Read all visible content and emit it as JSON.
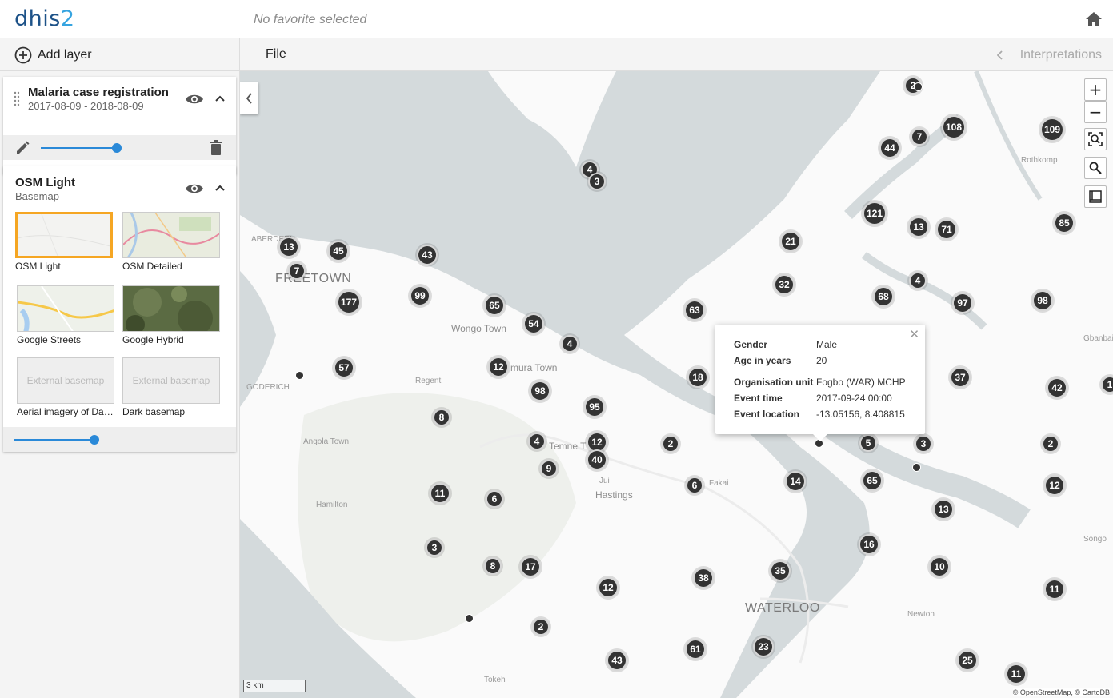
{
  "app": {
    "logo_main": "dhis",
    "logo_num": "2",
    "favorite": "No favorite selected"
  },
  "sidebar": {
    "add_layer_label": "Add layer",
    "layers": [
      {
        "title": "Malaria case registration",
        "subtitle": "2017-08-09 - 2018-08-09",
        "opacity": 0.8
      },
      {
        "title": "OSM Light",
        "subtitle": "Basemap",
        "opacity": 0.8
      }
    ],
    "basemaps": [
      {
        "name": "OSM Light",
        "selected": true
      },
      {
        "name": "OSM Detailed"
      },
      {
        "name": "Google Streets"
      },
      {
        "name": "Google Hybrid"
      },
      {
        "name": "Aerial imagery of Dar...",
        "placeholder": "External basemap"
      },
      {
        "name": "Dark basemap",
        "placeholder": "External basemap"
      }
    ]
  },
  "toolbar": {
    "file_label": "File",
    "interpretations_label": "Interpretations"
  },
  "map": {
    "zoom_in": "+",
    "zoom_out": "−",
    "scale_label": "3 km",
    "attribution": "© OpenStreetMap, © CartoDB",
    "places": [
      {
        "name": "FREETOWN",
        "cls": "big"
      },
      {
        "name": "Wongo Town"
      },
      {
        "name": "mura Town"
      },
      {
        "name": "Regent"
      },
      {
        "name": "Temne T"
      },
      {
        "name": "Angola Town"
      },
      {
        "name": "Hamilton"
      },
      {
        "name": "Hastings"
      },
      {
        "name": "Jui",
        "cls": "small"
      },
      {
        "name": "Fakai",
        "cls": "small"
      },
      {
        "name": "WATERLOO",
        "cls": "big"
      },
      {
        "name": "Newton",
        "cls": "small"
      },
      {
        "name": "Songo",
        "cls": "small"
      },
      {
        "name": "Gbanbai",
        "cls": "small"
      },
      {
        "name": "Rothkomp",
        "cls": "small"
      },
      {
        "name": "ABERDEEN",
        "cls": "small"
      },
      {
        "name": "GODERICH",
        "cls": "small"
      },
      {
        "name": "Tokeh",
        "cls": "small"
      }
    ],
    "clusters": [
      "2",
      "7",
      "108",
      "109",
      "44",
      "4",
      "3",
      "121",
      "13",
      "71",
      "85",
      "21",
      "13",
      "45",
      "43",
      "7",
      "4",
      "32",
      "68",
      "97",
      "98",
      "177",
      "99",
      "65",
      "54",
      "63",
      "4",
      "57",
      "12",
      "18",
      "37",
      "42",
      "1",
      "98",
      "95",
      "8",
      "4",
      "12",
      "40",
      "2",
      "5",
      "3",
      "2",
      "9",
      "6",
      "14",
      "65",
      "12",
      "11",
      "6",
      "13",
      "16",
      "3",
      "8",
      "17",
      "12",
      "38",
      "35",
      "10",
      "11",
      "2",
      "43",
      "61",
      "23",
      "25",
      "11"
    ],
    "popup": {
      "rows": [
        {
          "k": "Gender",
          "v": "Male"
        },
        {
          "k": "Age in years",
          "v": "20"
        },
        {
          "k": "Organisation unit",
          "v": "Fogbo (WAR) MCHP"
        },
        {
          "k": "Event time",
          "v": "2017-09-24 00:00"
        },
        {
          "k": "Event location",
          "v": "-13.05156, 8.408815"
        }
      ]
    }
  },
  "colors": {
    "accent": "#2a89d8",
    "selected_border": "#f5a623",
    "cluster": "#333333",
    "water": "#d4dadc",
    "land": "#fafafa",
    "forest": "#eef0ec"
  }
}
